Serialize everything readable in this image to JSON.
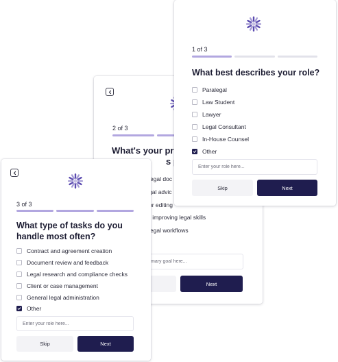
{
  "colors": {
    "accent": "#1f1d4f",
    "progress_active": "#b2a7e0",
    "progress_inactive": "#e2e2ea",
    "logo": "#5b4bb0"
  },
  "icons": {
    "back": "chevron-left-icon",
    "logo": "brand-logo",
    "check": "checkmark-icon"
  },
  "card_role": {
    "step": "1 of 3",
    "progress_filled": 1,
    "progress_total": 3,
    "question": "What best describes your role?",
    "options": [
      {
        "label": "Paralegal",
        "checked": false
      },
      {
        "label": "Law Student",
        "checked": false
      },
      {
        "label": "Lawyer",
        "checked": false
      },
      {
        "label": "Legal Consultant",
        "checked": false
      },
      {
        "label": "In-House Counsel",
        "checked": false
      },
      {
        "label": "Other",
        "checked": true
      }
    ],
    "input_placeholder": "Enter your role here...",
    "skip_label": "Skip",
    "next_label": "Next"
  },
  "card_goal": {
    "step": "2 of 3",
    "progress_filled": 2,
    "progress_total": 3,
    "question_line1": "What's your pri",
    "question_line2": "s platf",
    "visible_fragments": [
      "legal doc",
      "gal advic",
      "or editing",
      "r improving legal skills",
      "legal workflows"
    ],
    "input_placeholder_fragment": "mary goal here...",
    "next_label": "Next"
  },
  "card_tasks": {
    "step": "3 of 3",
    "progress_filled": 3,
    "progress_total": 3,
    "question": "What type of tasks do you handle most often?",
    "options": [
      {
        "label": "Contract and agreement creation",
        "checked": false
      },
      {
        "label": "Document review and feedback",
        "checked": false
      },
      {
        "label": "Legal research and compliance checks",
        "checked": false
      },
      {
        "label": "Client or case management",
        "checked": false
      },
      {
        "label": "General legal administration",
        "checked": false
      },
      {
        "label": "Other",
        "checked": true
      }
    ],
    "input_placeholder": "Enter your role here...",
    "skip_label": "Skip",
    "next_label": "Next"
  }
}
